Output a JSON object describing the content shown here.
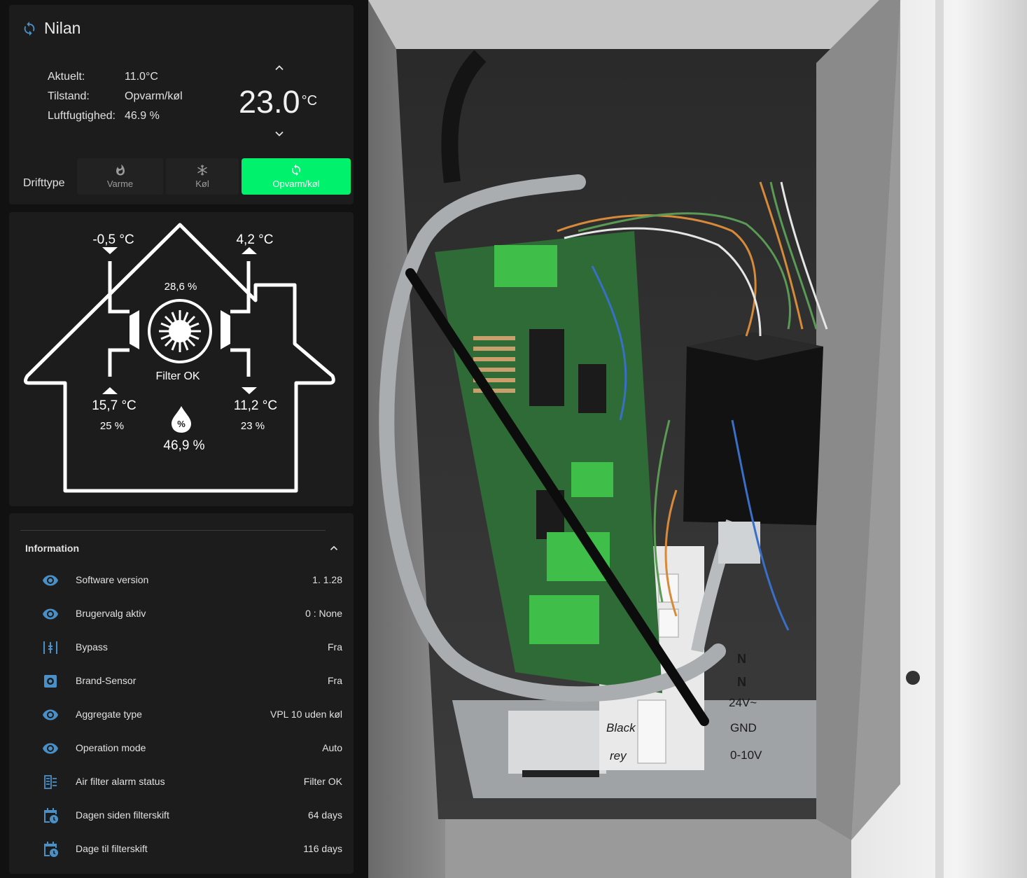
{
  "thermostat": {
    "name": "Nilan",
    "attributes": [
      {
        "label": "Aktuelt:",
        "value": "11.0°C"
      },
      {
        "label": "Tilstand:",
        "value": "Opvarm/køl"
      },
      {
        "label": "Luftfugtighed:",
        "value": "46.9 %"
      }
    ],
    "target_temp": "23.0",
    "target_unit": "°C",
    "mode_label": "Drifttype",
    "modes": [
      {
        "label": "Varme",
        "icon": "fire-icon",
        "active": false
      },
      {
        "label": "Køl",
        "icon": "snowflake-icon",
        "active": false
      },
      {
        "label": "Opvarm/køl",
        "icon": "sync-icon",
        "active": true
      }
    ],
    "accent_color": "#00f26d",
    "icon_color": "#4a90c8"
  },
  "house": {
    "outdoor_in_temp": "-0,5 °C",
    "exhaust_out_temp": "4,2 °C",
    "fan_speed": "28,6 %",
    "filter_status": "Filter OK",
    "supply_temp": "15,7 °C",
    "supply_humidity": "25 %",
    "extract_temp": "11,2 °C",
    "extract_humidity": "23 %",
    "room_humidity": "46,9 %"
  },
  "info": {
    "title": "Information",
    "rows": [
      {
        "icon": "eye-icon",
        "name": "Software version",
        "value": "1. 1.28"
      },
      {
        "icon": "eye-icon",
        "name": "Brugervalg aktiv",
        "value": "0 : None"
      },
      {
        "icon": "valve-icon",
        "name": "Bypass",
        "value": "Fra"
      },
      {
        "icon": "smoke-detector-icon",
        "name": "Brand-Sensor",
        "value": "Fra"
      },
      {
        "icon": "eye-icon",
        "name": "Aggregate type",
        "value": "VPL 10 uden køl"
      },
      {
        "icon": "eye-icon",
        "name": "Operation mode",
        "value": "Auto"
      },
      {
        "icon": "air-filter-icon",
        "name": "Air filter alarm status",
        "value": "Filter OK"
      },
      {
        "icon": "calendar-clock-icon",
        "name": "Dagen siden filterskift",
        "value": "64 days"
      },
      {
        "icon": "calendar-clock-icon",
        "name": "Dage til filterskift",
        "value": "116 days"
      }
    ]
  },
  "photo": {
    "terminal_labels": [
      "N",
      "N",
      "24V~",
      "GND",
      "0-10V"
    ],
    "wire_labels": [
      "Black",
      "rey"
    ]
  }
}
